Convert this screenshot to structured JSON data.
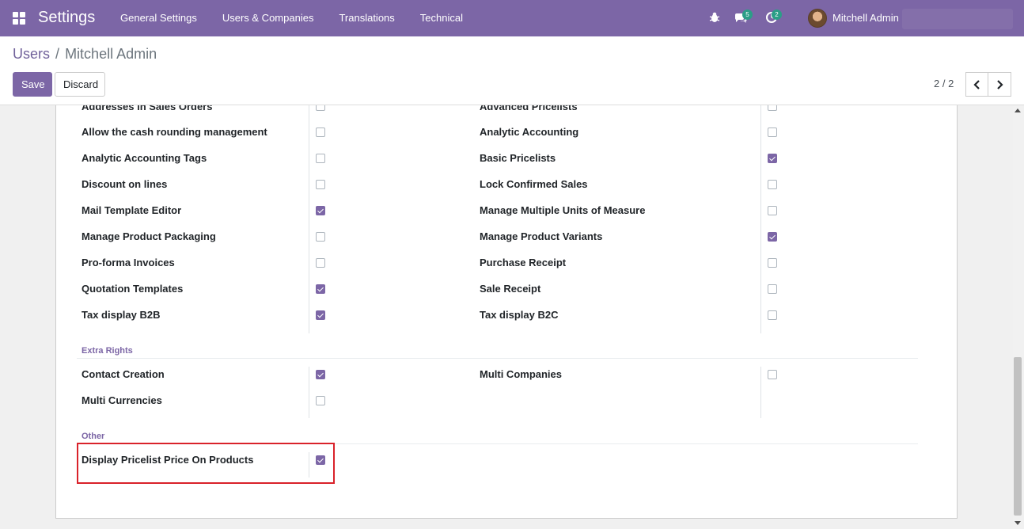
{
  "navbar": {
    "app_title": "Settings",
    "menu": [
      "General Settings",
      "Users & Companies",
      "Translations",
      "Technical"
    ],
    "chat_badge": "5",
    "activity_badge": "2",
    "user_name": "Mitchell Admin"
  },
  "breadcrumb": {
    "parent": "Users",
    "separator": "/",
    "current": "Mitchell Admin"
  },
  "buttons": {
    "save": "Save",
    "discard": "Discard"
  },
  "pager": {
    "value": "2 / 2"
  },
  "sections": {
    "extra_rights": "Extra Rights",
    "other": "Other"
  },
  "fields": {
    "addresses_sales_orders": {
      "label": "Addresses in Sales Orders",
      "checked": false
    },
    "advanced_pricelists": {
      "label": "Advanced Pricelists",
      "checked": false
    },
    "cash_rounding": {
      "label": "Allow the cash rounding management",
      "checked": false
    },
    "analytic_accounting": {
      "label": "Analytic Accounting",
      "checked": false
    },
    "analytic_tags": {
      "label": "Analytic Accounting Tags",
      "checked": false
    },
    "basic_pricelists": {
      "label": "Basic Pricelists",
      "checked": true
    },
    "discount_lines": {
      "label": "Discount on lines",
      "checked": false
    },
    "lock_confirmed_sales": {
      "label": "Lock Confirmed Sales",
      "checked": false
    },
    "mail_template_editor": {
      "label": "Mail Template Editor",
      "checked": true
    },
    "multi_uom": {
      "label": "Manage Multiple Units of Measure",
      "checked": false
    },
    "product_packaging": {
      "label": "Manage Product Packaging",
      "checked": false
    },
    "product_variants": {
      "label": "Manage Product Variants",
      "checked": true
    },
    "proforma_invoices": {
      "label": "Pro-forma Invoices",
      "checked": false
    },
    "purchase_receipt": {
      "label": "Purchase Receipt",
      "checked": false
    },
    "quotation_templates": {
      "label": "Quotation Templates",
      "checked": true
    },
    "sale_receipt": {
      "label": "Sale Receipt",
      "checked": false
    },
    "tax_b2b": {
      "label": "Tax display B2B",
      "checked": true
    },
    "tax_b2c": {
      "label": "Tax display B2C",
      "checked": false
    },
    "contact_creation": {
      "label": "Contact Creation",
      "checked": true
    },
    "multi_companies": {
      "label": "Multi Companies",
      "checked": false
    },
    "multi_currencies": {
      "label": "Multi Currencies",
      "checked": false
    },
    "display_pricelist_price": {
      "label": "Display Pricelist Price On Products",
      "checked": true
    }
  },
  "colors": {
    "brand": "#7c66a6",
    "highlight": "#d9222a"
  }
}
